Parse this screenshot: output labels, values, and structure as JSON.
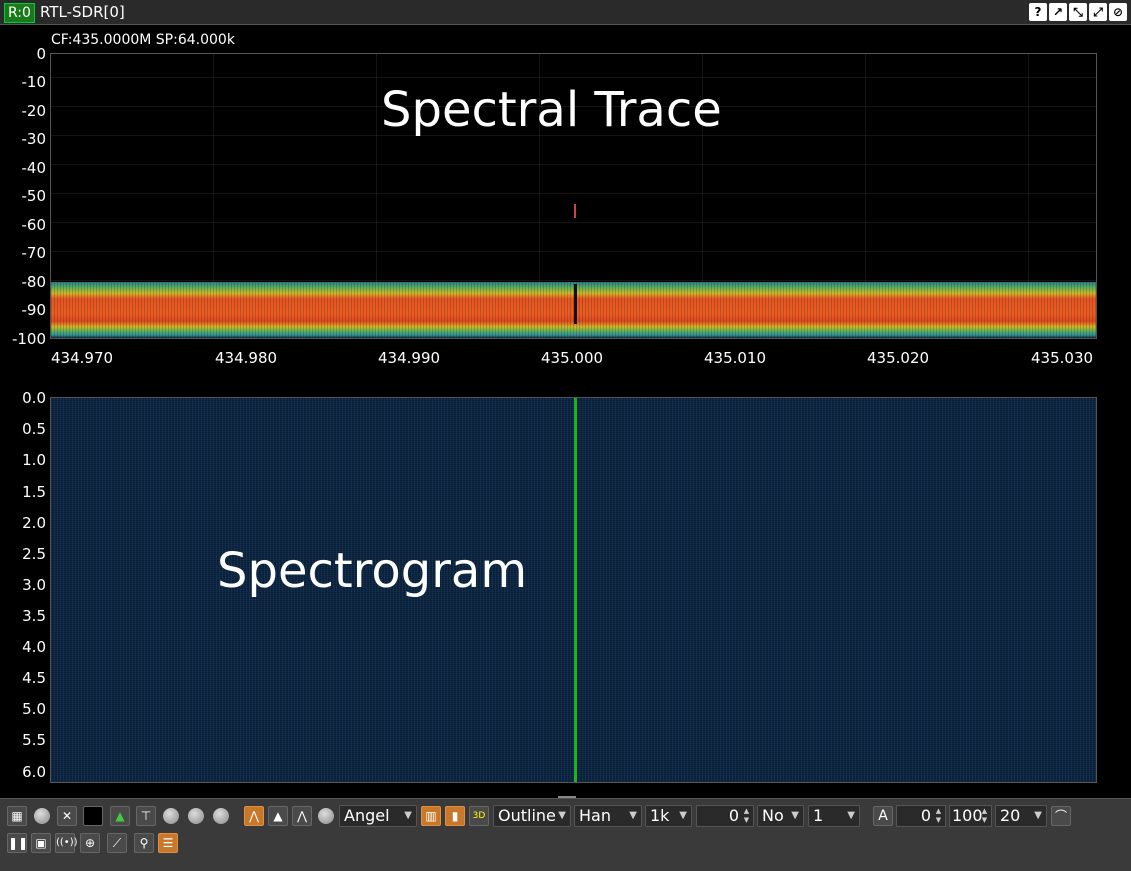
{
  "titlebar": {
    "rx_badge": "R:0",
    "device_title": "RTL-SDR[0]"
  },
  "spectrum": {
    "readout": "CF:435.0000M SP:64.000k",
    "annotation": "Spectral Trace",
    "y_ticks": [
      "0",
      "-10",
      "-20",
      "-30",
      "-40",
      "-50",
      "-60",
      "-70",
      "-80",
      "-90",
      "-100"
    ],
    "x_ticks": [
      "434.970",
      "434.980",
      "434.990",
      "435.000",
      "435.010",
      "435.020",
      "435.030"
    ]
  },
  "spectrogram": {
    "annotation": "Spectrogram",
    "y_ticks": [
      "0.0",
      "0.5",
      "1.0",
      "1.5",
      "2.0",
      "2.5",
      "3.0",
      "3.5",
      "4.0",
      "4.5",
      "5.0",
      "5.5",
      "6.0"
    ]
  },
  "toolbar": {
    "palette": "Angel",
    "trace_style": "Outline",
    "window": "Han",
    "fft_size": "1k",
    "offset": "0",
    "averaging": "No",
    "decim": "1",
    "auto_label": "A",
    "ref_level": "0",
    "range": "100",
    "fps": "20"
  },
  "colors": {
    "accent": "#c8782a",
    "center_line": "#1db31d",
    "noise": "#d9572a"
  }
}
